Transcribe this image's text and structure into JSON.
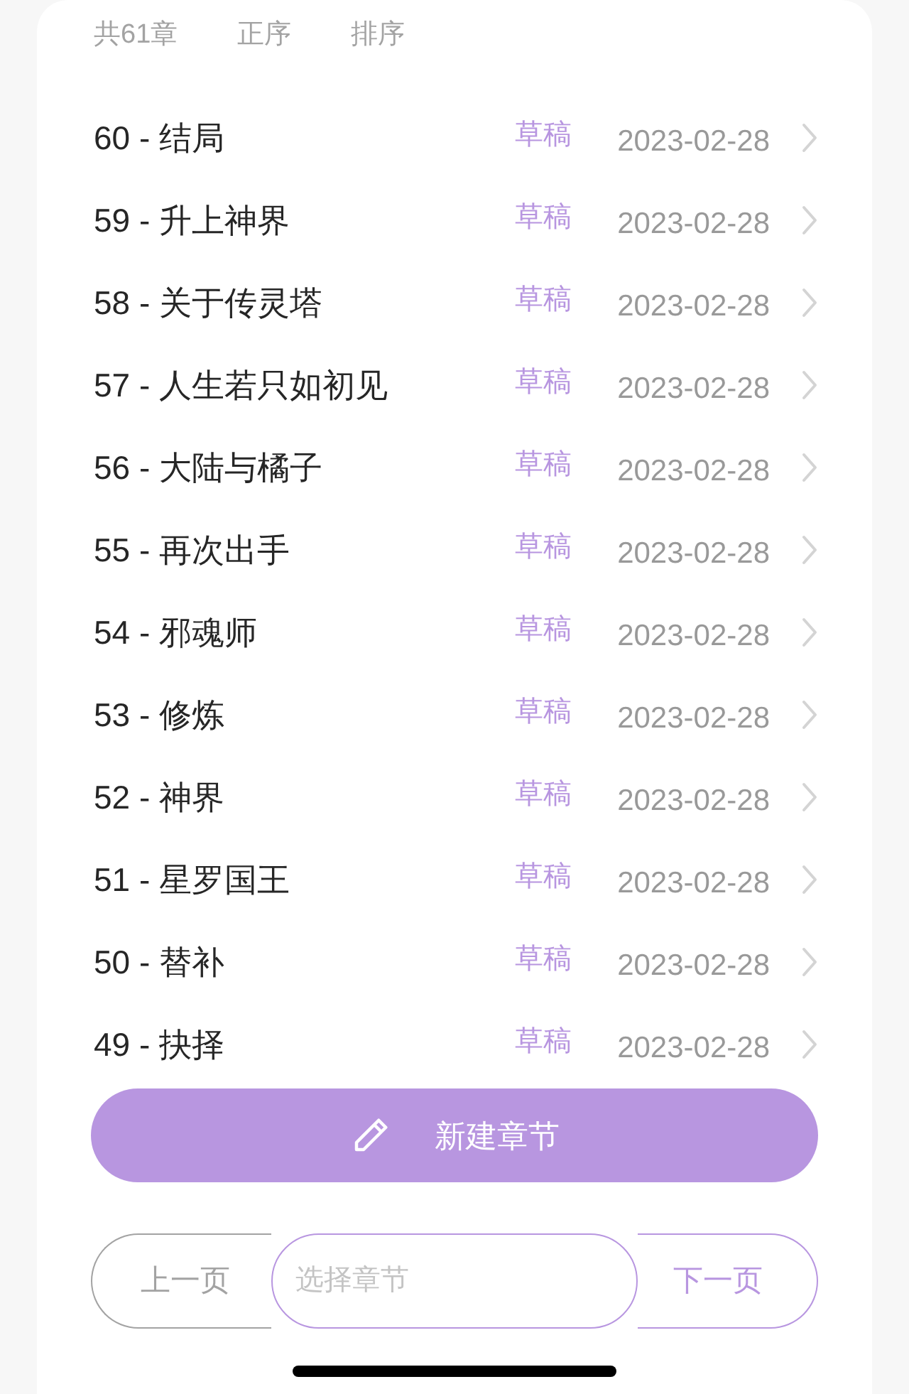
{
  "header": {
    "count": "共61章",
    "sort_options": [
      {
        "label": "正序"
      },
      {
        "label": "排序"
      }
    ]
  },
  "chapters": [
    {
      "title": "60 - 结局",
      "status": "草稿",
      "date": "2023-02-28"
    },
    {
      "title": "59 - 升上神界",
      "status": "草稿",
      "date": "2023-02-28"
    },
    {
      "title": "58 - 关于传灵塔",
      "status": "草稿",
      "date": "2023-02-28"
    },
    {
      "title": "57 - 人生若只如初见",
      "status": "草稿",
      "date": "2023-02-28"
    },
    {
      "title": "56 - 大陆与橘子",
      "status": "草稿",
      "date": "2023-02-28"
    },
    {
      "title": "55 - 再次出手",
      "status": "草稿",
      "date": "2023-02-28"
    },
    {
      "title": "54 - 邪魂师",
      "status": "草稿",
      "date": "2023-02-28"
    },
    {
      "title": "53 - 修炼",
      "status": "草稿",
      "date": "2023-02-28"
    },
    {
      "title": "52 - 神界",
      "status": "草稿",
      "date": "2023-02-28"
    },
    {
      "title": "51 - 星罗国王",
      "status": "草稿",
      "date": "2023-02-28"
    },
    {
      "title": "50 - 替补",
      "status": "草稿",
      "date": "2023-02-28"
    },
    {
      "title": "49 - 抉择",
      "status": "草稿",
      "date": "2023-02-28"
    }
  ],
  "new_chapter_button": {
    "label": "新建章节"
  },
  "pager": {
    "prev": {
      "label": "上一页",
      "disabled": true
    },
    "chapter_select": {
      "placeholder": "选择章节"
    },
    "next": {
      "label": "下一页",
      "disabled": false
    }
  }
}
